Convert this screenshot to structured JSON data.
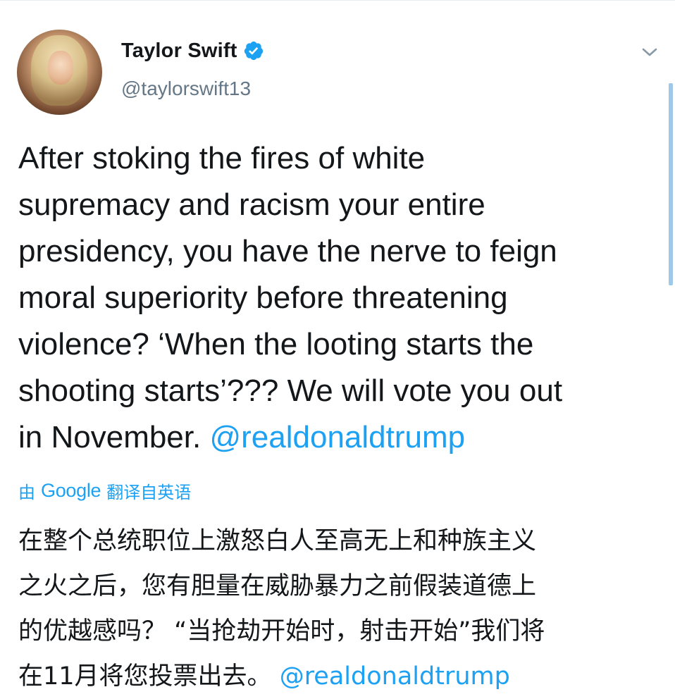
{
  "tweet": {
    "author": {
      "display_name": "Taylor Swift",
      "handle": "@taylorswift13",
      "verified": true,
      "avatar_icon": "profile-photo"
    },
    "text_lines": [
      "After stoking the fires of white",
      "supremacy and racism your entire",
      "presidency, you have the nerve to feign",
      "moral superiority before threatening",
      "violence? ‘When the looting starts the",
      "shooting starts’??? We will vote you out",
      "in November."
    ],
    "mention": "@realdonaldtrump",
    "translation": {
      "prefix": "由",
      "provider": "Google",
      "suffix": "翻译自英语",
      "lines": [
        "在整个总统职位上激怒白人至高无上和种族主义",
        "之火之后，您有胆量在威胁暴力之前假装道德上",
        "的优越感吗？ “当抢劫开始时，射击开始”我们将",
        "在11月将您投票出去。"
      ],
      "mention": "@realdonaldtrump"
    }
  },
  "colors": {
    "accent": "#1da1f2",
    "text": "#14171a",
    "secondary": "#657786"
  },
  "icons": {
    "verified": "verified-badge-icon",
    "caret": "chevron-down-icon"
  }
}
